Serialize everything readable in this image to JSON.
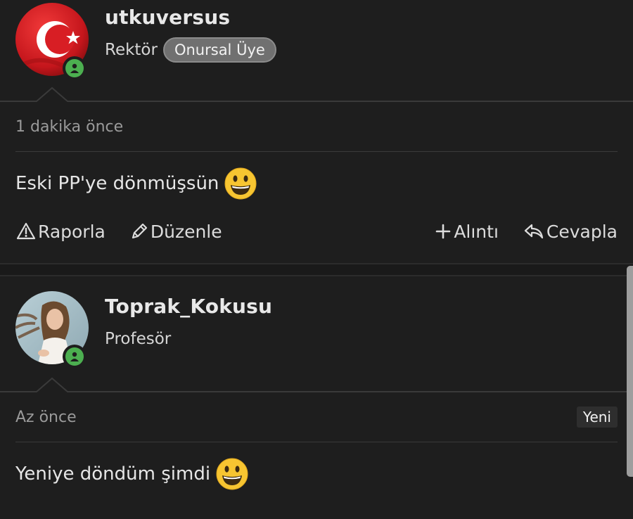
{
  "posts": [
    {
      "username": "utkuversus",
      "rank": "Rektör",
      "badge": "Onursal Üye",
      "time": "1 dakika önce",
      "message": "Eski PP'ye dönmüşsün",
      "actions": {
        "report": "Raporla",
        "edit": "Düzenle",
        "quote": "Alıntı",
        "reply": "Cevapla"
      }
    },
    {
      "username": "Toprak_Kokusu",
      "rank": "Profesör",
      "time": "Az önce",
      "new_label": "Yeni",
      "message": "Yeniye döndüm şimdi"
    }
  ],
  "icons": {
    "status": "online-icon",
    "report": "warning-triangle-icon",
    "edit": "pencil-icon",
    "quote": "plus-icon",
    "reply": "reply-arrow-icon",
    "emoji": "grinning-face-emoji"
  },
  "colors": {
    "background": "#1e1e1e",
    "online": "#4caf50",
    "badge": "#707070",
    "flag_red": "#d81e24"
  }
}
